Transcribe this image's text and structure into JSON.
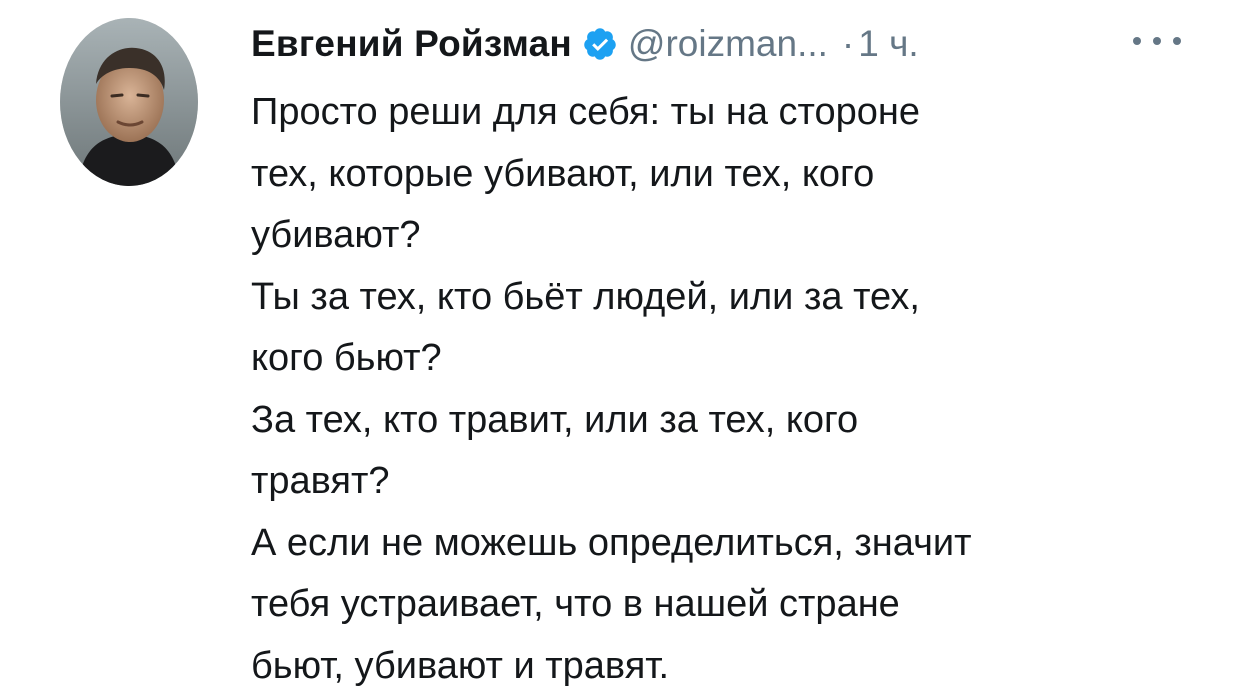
{
  "author": {
    "name": "Евгений Ройзман",
    "handle": "@roizman...",
    "separator": "·",
    "time": "1 ч.",
    "verified_icon": "verified-badge-icon",
    "avatar_icon": "profile-photo"
  },
  "more_icon": "more-options-icon",
  "tweet": {
    "lines": [
      "Просто реши для себя: ты на стороне",
      "тех, которые убивают, или тех, кого",
      "убивают?",
      "Ты за тех, кто бьёт людей, или за тех,",
      "кого бьют?",
      "За тех, кто травит, или за тех, кого",
      "травят?",
      "А если не можешь определиться, значит",
      "тебя устраивает, что в нашей стране",
      "бьют, убивают и травят."
    ]
  },
  "colors": {
    "text": "#14171a",
    "secondary": "#657786",
    "verified": "#1da1f2"
  }
}
